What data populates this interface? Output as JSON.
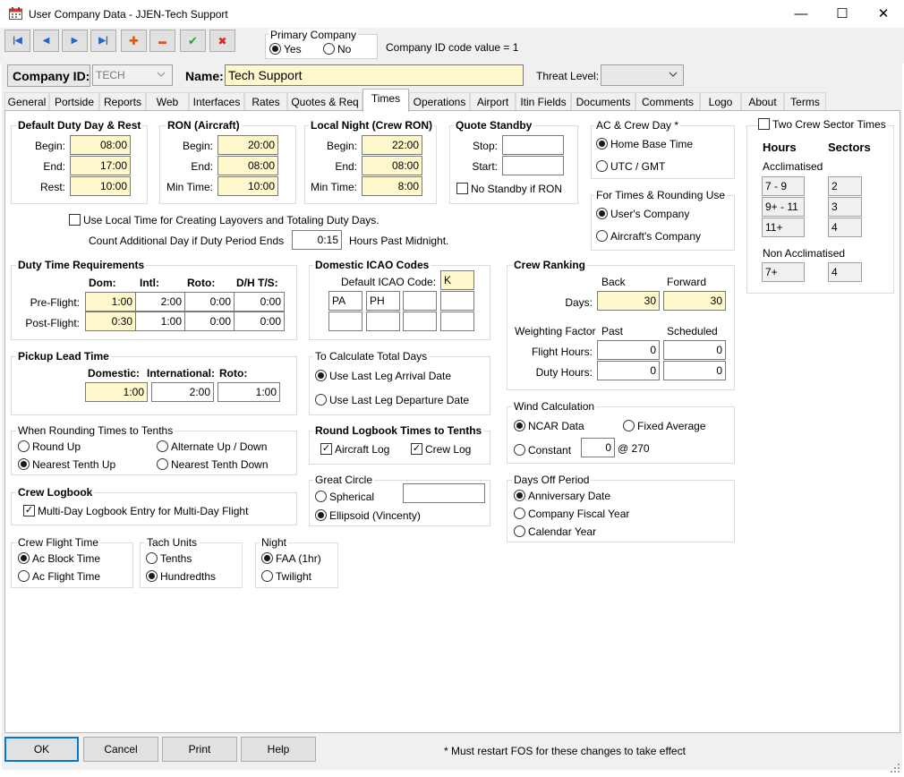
{
  "window": {
    "title": "User Company Data - JJEN-Tech Support",
    "minimize": "—",
    "maximize": "☐",
    "close": "✕"
  },
  "toolbar": {
    "first": "|◀",
    "prev": "◀",
    "next": "▶",
    "last": "▶|",
    "add": "✚",
    "remove": "▬",
    "save": "✔",
    "cancel": "✖",
    "primary_company_title": "Primary Company",
    "yes": "Yes",
    "no": "No",
    "company_id_code": "Company ID code value = 1"
  },
  "header": {
    "company_id_label": "Company ID:",
    "company_id_value": "TECH",
    "name_label": "Name:",
    "name_value": "Tech Support",
    "threat_label": "Threat Level:",
    "threat_value": ""
  },
  "tabs": [
    "General",
    "Portside",
    "Reports",
    "Web",
    "Interfaces",
    "Rates",
    "Quotes & Req",
    "Times",
    "Operations",
    "Airport",
    "Itin Fields",
    "Documents",
    "Comments",
    "Logo",
    "About",
    "Terms"
  ],
  "default_duty": {
    "title": "Default Duty Day & Rest",
    "begin_label": "Begin:",
    "begin": "08:00",
    "end_label": "End:",
    "end": "17:00",
    "rest_label": "Rest:",
    "rest": "10:00"
  },
  "ron": {
    "title": "RON (Aircraft)",
    "begin_label": "Begin:",
    "begin": "20:00",
    "end_label": "End:",
    "end": "08:00",
    "min_label": "Min Time:",
    "min": "10:00"
  },
  "local_night": {
    "title": "Local Night (Crew RON)",
    "begin_label": "Begin:",
    "begin": "22:00",
    "end_label": "End:",
    "end": "08:00",
    "min_label": "Min Time:",
    "min": "8:00"
  },
  "quote_standby": {
    "title": "Quote Standby",
    "stop_label": "Stop:",
    "stop": "",
    "start_label": "Start:",
    "start": "",
    "no_standby": "No Standby if RON"
  },
  "ac_crew_day": {
    "title": "AC & Crew Day *",
    "home_base": "Home Base Time",
    "utc": "UTC / GMT"
  },
  "rounding_use": {
    "title": "For Times & Rounding Use",
    "users_company": "User's Company",
    "aircraft_company": "Aircraft's Company"
  },
  "two_crew": {
    "title": "Two Crew Sector Times",
    "hours_label": "Hours",
    "sectors_label": "Sectors",
    "acclimatised_label": "Acclimatised",
    "acclimatised": [
      {
        "hours": "7 - 9",
        "sectors": "2"
      },
      {
        "hours": "9+ - 11",
        "sectors": "3"
      },
      {
        "hours": "11+",
        "sectors": "4"
      }
    ],
    "non_acclimatised_label": "Non Acclimatised",
    "non_acclimatised": {
      "hours": "7+",
      "sectors": "4"
    }
  },
  "local_time": {
    "use_local_label": "Use Local Time for Creating Layovers and Totaling Duty Days.",
    "count_label": "Count Additional Day if Duty Period Ends",
    "count_value": "0:15",
    "hours_past": "Hours Past Midnight."
  },
  "duty_time": {
    "title": "Duty Time Requirements",
    "dom": "Dom:",
    "intl": "Intl:",
    "roto": "Roto:",
    "dh": "D/H T/S:",
    "pre_label": "Pre-Flight:",
    "pre": [
      "1:00",
      "2:00",
      "0:00",
      "0:00"
    ],
    "post_label": "Post-Flight:",
    "post": [
      "0:30",
      "1:00",
      "0:00",
      "0:00"
    ]
  },
  "icao": {
    "title": "Domestic ICAO Codes",
    "default_label": "Default ICAO Code:",
    "default": "K",
    "codes": [
      "PA",
      "PH",
      "",
      "",
      "",
      "",
      "",
      ""
    ]
  },
  "crew_ranking": {
    "title": "Crew Ranking",
    "back": "Back",
    "forward": "Forward",
    "days_label": "Days:",
    "days_back": "30",
    "days_forward": "30",
    "weighting": "Weighting Factor",
    "past": "Past",
    "scheduled": "Scheduled",
    "flight_label": "Flight Hours:",
    "flight_past": "0",
    "flight_sched": "0",
    "duty_label": "Duty Hours:",
    "duty_past": "0",
    "duty_sched": "0"
  },
  "pickup": {
    "title": "Pickup Lead Time",
    "dom_label": "Domestic:",
    "dom": "1:00",
    "intl_label": "International:",
    "intl": "2:00",
    "roto_label": "Roto:",
    "roto": "1:00"
  },
  "total_days": {
    "title": "To Calculate Total Days",
    "arrival": "Use Last Leg Arrival Date",
    "departure": "Use Last Leg Departure Date"
  },
  "wind": {
    "title": "Wind Calculation",
    "ncar": "NCAR Data",
    "fixed": "Fixed Average",
    "constant": "Constant",
    "constant_value": "0",
    "at": "@ 270"
  },
  "tenths": {
    "title": "When Rounding Times to Tenths",
    "round_up": "Round Up",
    "alternate": "Alternate Up / Down",
    "nearest_up": "Nearest Tenth Up",
    "nearest_down": "Nearest Tenth Down"
  },
  "logbook_round": {
    "title": "Round Logbook Times to Tenths",
    "aircraft": "Aircraft Log",
    "crew": "Crew Log"
  },
  "crew_logbook": {
    "title": "Crew Logbook",
    "multi_day": "Multi-Day Logbook Entry for Multi-Day Flight"
  },
  "great_circle": {
    "title": "Great Circle",
    "spherical": "Spherical",
    "spherical_value": "",
    "ellipsoid": "Ellipsoid (Vincenty)"
  },
  "days_off": {
    "title": "Days Off Period",
    "anniversary": "Anniversary Date",
    "fiscal": "Company Fiscal Year",
    "calendar": "Calendar Year"
  },
  "crew_flight": {
    "title": "Crew Flight Time",
    "block": "Ac Block Time",
    "flight": "Ac Flight Time"
  },
  "tach": {
    "title": "Tach Units",
    "tenths": "Tenths",
    "hundredths": "Hundredths"
  },
  "night": {
    "title": "Night",
    "faa": "FAA (1hr)",
    "twilight": "Twilight"
  },
  "footer": {
    "ok": "OK",
    "cancel": "Cancel",
    "print": "Print",
    "help": "Help",
    "note": "* Must restart FOS for these changes to take effect"
  }
}
